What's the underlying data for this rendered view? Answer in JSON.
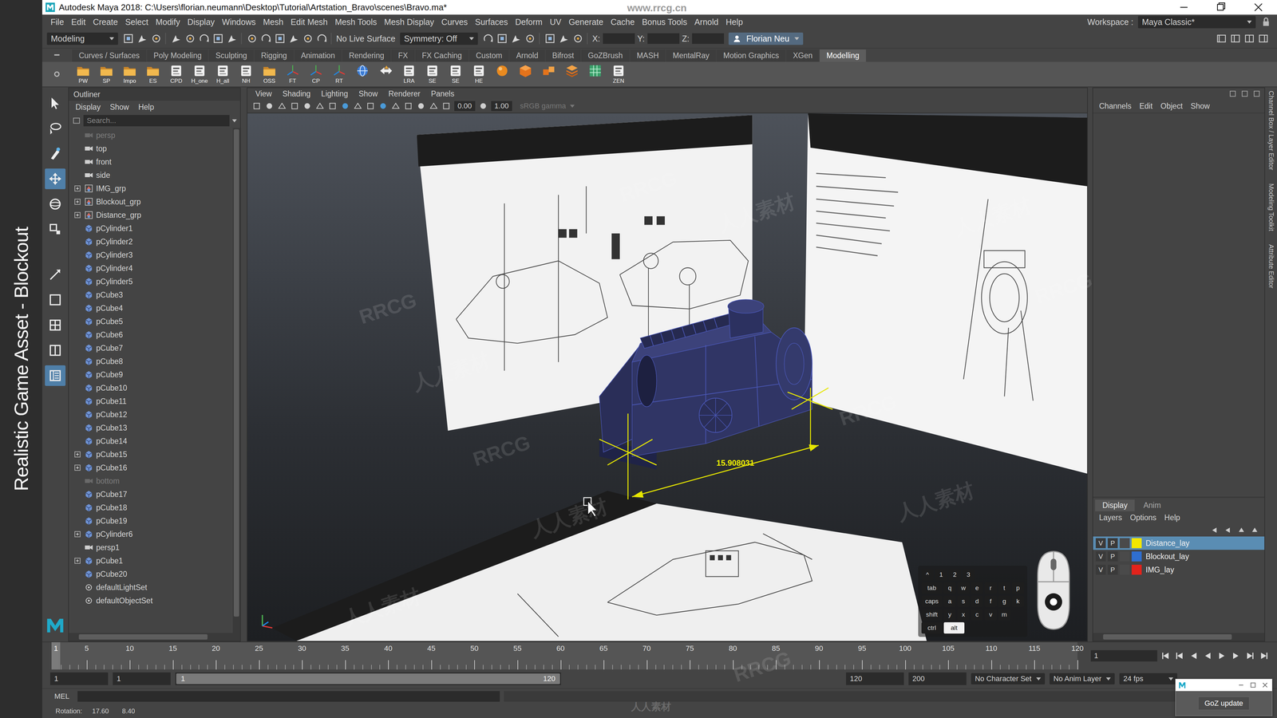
{
  "overlay_caption": "Realistic Game Asset - Blockout",
  "window": {
    "title": "Autodesk Maya 2018: C:\\Users\\florian.neumann\\Desktop\\Tutorial\\Artstation_Bravo\\scenes\\Bravo.ma*"
  },
  "menu": [
    "File",
    "Edit",
    "Create",
    "Select",
    "Modify",
    "Display",
    "Windows",
    "Mesh",
    "Edit Mesh",
    "Mesh Tools",
    "Mesh Display",
    "Curves",
    "Surfaces",
    "Deform",
    "UV",
    "Generate",
    "Cache",
    "Bonus Tools",
    "Arnold",
    "Help"
  ],
  "workspace": {
    "label": "Workspace :",
    "value": "Maya Classic*"
  },
  "status_line": {
    "menu_set": "Modeling",
    "live_surface": "No Live Surface",
    "symmetry": "Symmetry: Off",
    "coords": [
      "X:",
      "Y:",
      "Z:"
    ],
    "user": "Florian Neu"
  },
  "shelf": {
    "tabs": [
      {
        "label": "Curves / Surfaces",
        "selected": false
      },
      {
        "label": "Poly Modeling",
        "selected": false
      },
      {
        "label": "Sculpting",
        "selected": false
      },
      {
        "label": "Rigging",
        "selected": false
      },
      {
        "label": "Animation",
        "selected": false
      },
      {
        "label": "Rendering",
        "selected": false
      },
      {
        "label": "FX",
        "selected": false
      },
      {
        "label": "FX Caching",
        "selected": false
      },
      {
        "label": "Custom",
        "selected": false
      },
      {
        "label": "Arnold",
        "selected": false
      },
      {
        "label": "Bifrost",
        "selected": false
      },
      {
        "label": "GoZBrush",
        "selected": false
      },
      {
        "label": "MASH",
        "selected": false
      },
      {
        "label": "MentalRay",
        "selected": false
      },
      {
        "label": "Motion Graphics",
        "selected": false
      },
      {
        "label": "XGen",
        "selected": false
      },
      {
        "label": "Modelling",
        "selected": true
      }
    ],
    "items": [
      {
        "label": "PW",
        "kind": "folder"
      },
      {
        "label": "SP",
        "kind": "folder"
      },
      {
        "label": "Impo",
        "kind": "folder"
      },
      {
        "label": "ES",
        "kind": "folder"
      },
      {
        "label": "CPD",
        "kind": "tool"
      },
      {
        "label": "H_one",
        "kind": "tool"
      },
      {
        "label": "H_all",
        "kind": "tool"
      },
      {
        "label": "NH",
        "kind": "tool"
      },
      {
        "label": "OSS",
        "kind": "folder"
      },
      {
        "label": "FT",
        "kind": "axis"
      },
      {
        "label": "CP",
        "kind": "axis"
      },
      {
        "label": "RT",
        "kind": "axis"
      },
      {
        "label": "",
        "kind": "globe"
      },
      {
        "label": "",
        "kind": "arrows"
      },
      {
        "label": "LRA",
        "kind": "tool"
      },
      {
        "label": "SE",
        "kind": "tool"
      },
      {
        "label": "SE",
        "kind": "tool"
      },
      {
        "label": "HE",
        "kind": "tool"
      },
      {
        "label": "",
        "kind": "sphere"
      },
      {
        "label": "",
        "kind": "cube"
      },
      {
        "label": "",
        "kind": "cubes"
      },
      {
        "label": "",
        "kind": "stack"
      },
      {
        "label": "",
        "kind": "grid"
      },
      {
        "label": "ZEN",
        "kind": "tool"
      }
    ]
  },
  "toolbox": [
    {
      "kind": "select",
      "selected": false
    },
    {
      "kind": "lasso",
      "selected": false
    },
    {
      "kind": "paint",
      "selected": false
    },
    {
      "kind": "move",
      "selected": true
    },
    {
      "kind": "rotate",
      "selected": false
    },
    {
      "kind": "scale",
      "selected": false
    },
    {
      "kind": "last",
      "selected": false
    },
    {
      "kind": "single",
      "selected": false
    },
    {
      "kind": "quad",
      "selected": false
    },
    {
      "kind": "split",
      "selected": false
    },
    {
      "kind": "outliner",
      "selected": true
    }
  ],
  "outliner": {
    "title": "Outliner",
    "menu": [
      "Display",
      "Show",
      "Help"
    ],
    "search": {
      "placeholder": "Search..."
    },
    "items": [
      {
        "name": "persp",
        "kind": "camera",
        "expandable": false,
        "hidden": true
      },
      {
        "name": "top",
        "kind": "camera",
        "expandable": false,
        "hidden": false
      },
      {
        "name": "front",
        "kind": "camera",
        "expandable": false,
        "hidden": false
      },
      {
        "name": "side",
        "kind": "camera",
        "expandable": false,
        "hidden": false
      },
      {
        "name": "IMG_grp",
        "kind": "group",
        "expandable": true,
        "hidden": false
      },
      {
        "name": "Blockout_grp",
        "kind": "group",
        "expandable": true,
        "hidden": false
      },
      {
        "name": "Distance_grp",
        "kind": "group",
        "expandable": true,
        "hidden": false
      },
      {
        "name": "pCylinder1",
        "kind": "mesh",
        "expandable": false,
        "hidden": false
      },
      {
        "name": "pCylinder2",
        "kind": "mesh",
        "expandable": false,
        "hidden": false
      },
      {
        "name": "pCylinder3",
        "kind": "mesh",
        "expandable": false,
        "hidden": false
      },
      {
        "name": "pCylinder4",
        "kind": "mesh",
        "expandable": false,
        "hidden": false
      },
      {
        "name": "pCylinder5",
        "kind": "mesh",
        "expandable": false,
        "hidden": false
      },
      {
        "name": "pCube3",
        "kind": "mesh",
        "expandable": false,
        "hidden": false
      },
      {
        "name": "pCube4",
        "kind": "mesh",
        "expandable": false,
        "hidden": false
      },
      {
        "name": "pCube5",
        "kind": "mesh",
        "expandable": false,
        "hidden": false
      },
      {
        "name": "pCube6",
        "kind": "mesh",
        "expandable": false,
        "hidden": false
      },
      {
        "name": "pCube7",
        "kind": "mesh",
        "expandable": false,
        "hidden": false
      },
      {
        "name": "pCube8",
        "kind": "mesh",
        "expandable": false,
        "hidden": false
      },
      {
        "name": "pCube9",
        "kind": "mesh",
        "expandable": false,
        "hidden": false
      },
      {
        "name": "pCube10",
        "kind": "mesh",
        "expandable": false,
        "hidden": false
      },
      {
        "name": "pCube11",
        "kind": "mesh",
        "expandable": false,
        "hidden": false
      },
      {
        "name": "pCube12",
        "kind": "mesh",
        "expandable": false,
        "hidden": false
      },
      {
        "name": "pCube13",
        "kind": "mesh",
        "expandable": false,
        "hidden": false
      },
      {
        "name": "pCube14",
        "kind": "mesh",
        "expandable": false,
        "hidden": false
      },
      {
        "name": "pCube15",
        "kind": "mesh",
        "expandable": true,
        "hidden": false
      },
      {
        "name": "pCube16",
        "kind": "mesh",
        "expandable": true,
        "hidden": false
      },
      {
        "name": "bottom",
        "kind": "camera",
        "expandable": false,
        "hidden": true
      },
      {
        "name": "pCube17",
        "kind": "mesh",
        "expandable": false,
        "hidden": false
      },
      {
        "name": "pCube18",
        "kind": "mesh",
        "expandable": false,
        "hidden": false
      },
      {
        "name": "pCube19",
        "kind": "mesh",
        "expandable": false,
        "hidden": false
      },
      {
        "name": "pCylinder6",
        "kind": "mesh",
        "expandable": true,
        "hidden": false
      },
      {
        "name": "persp1",
        "kind": "camera",
        "expandable": false,
        "hidden": false
      },
      {
        "name": "pCube1",
        "kind": "mesh",
        "expandable": true,
        "hidden": false
      },
      {
        "name": "pCube20",
        "kind": "mesh",
        "expandable": false,
        "hidden": false
      },
      {
        "name": "defaultLightSet",
        "kind": "set",
        "expandable": false,
        "hidden": false
      },
      {
        "name": "defaultObjectSet",
        "kind": "set",
        "expandable": false,
        "hidden": false
      }
    ]
  },
  "viewport": {
    "menu": [
      "View",
      "Shading",
      "Lighting",
      "Show",
      "Renderer",
      "Panels"
    ],
    "fields": [
      "0.00",
      "1.00"
    ],
    "color_space": "sRGB gamma",
    "measurement": "15.908031"
  },
  "keyboard_overlay": {
    "rows": [
      [
        {
          "label": "^",
          "pressed": false
        },
        {
          "label": "1",
          "pressed": false
        },
        {
          "label": "2",
          "pressed": false
        },
        {
          "label": "3",
          "pressed": false
        }
      ],
      [
        {
          "label": "tab",
          "pressed": false
        },
        {
          "label": "q",
          "pressed": false
        },
        {
          "label": "w",
          "pressed": false
        },
        {
          "label": "e",
          "pressed": false
        },
        {
          "label": "r",
          "pressed": false
        },
        {
          "label": "t",
          "pressed": false
        },
        {
          "label": "p",
          "pressed": false
        }
      ],
      [
        {
          "label": "caps",
          "pressed": false
        },
        {
          "label": "a",
          "pressed": false
        },
        {
          "label": "s",
          "pressed": false
        },
        {
          "label": "d",
          "pressed": false
        },
        {
          "label": "f",
          "pressed": false
        },
        {
          "label": "g",
          "pressed": false
        },
        {
          "label": "k",
          "pressed": false
        }
      ],
      [
        {
          "label": "shift",
          "pressed": false
        },
        {
          "label": "y",
          "pressed": false
        },
        {
          "label": "x",
          "pressed": false
        },
        {
          "label": "c",
          "pressed": false
        },
        {
          "label": "v",
          "pressed": false
        },
        {
          "label": "m",
          "pressed": false
        }
      ],
      [
        {
          "label": "ctrl",
          "pressed": false
        },
        {
          "label": "alt",
          "pressed": true
        }
      ]
    ]
  },
  "channel_box": {
    "tabs": [
      "Channels",
      "Edit",
      "Object",
      "Show"
    ]
  },
  "layer_editor": {
    "tabs": [
      {
        "label": "Display",
        "selected": true
      },
      {
        "label": "Anim",
        "selected": false
      }
    ],
    "menu": [
      "Layers",
      "Options",
      "Help"
    ],
    "layers": [
      {
        "v": "V",
        "p": "P",
        "name": "Distance_lay",
        "color": "#f2e600",
        "selected": true
      },
      {
        "v": "V",
        "p": "P",
        "name": "Blockout_lay",
        "color": "#2f6fd0",
        "selected": false
      },
      {
        "v": "V",
        "p": "P",
        "name": "IMG_lay",
        "color": "#e2231c",
        "selected": false
      }
    ]
  },
  "side_tabs": [
    "Channel Box / Layer Editor",
    "Modeling Toolkit",
    "Attribute Editor"
  ],
  "timeline": {
    "current": "1",
    "ticks": [
      "5",
      "10",
      "15",
      "20",
      "25",
      "30",
      "35",
      "40",
      "45",
      "50",
      "55",
      "60",
      "65",
      "70",
      "75",
      "80",
      "85",
      "90",
      "95",
      "100",
      "105",
      "110",
      "115",
      "120"
    ],
    "frame_field": "1"
  },
  "range": {
    "start": "1",
    "playback_start": "1",
    "slider_start": "1",
    "slider_end": "120",
    "playback_end": "120",
    "end": "200",
    "character_set": "No Character Set",
    "anim_layer": "No Anim Layer",
    "fps": "24 fps"
  },
  "command_line": {
    "language": "MEL"
  },
  "help_line": {
    "label": "Rotation:",
    "values": [
      "17.60",
      "8.40"
    ]
  },
  "goz": {
    "button": "GoZ update"
  },
  "watermarks": [
    {
      "text": "www.rrcg.cn",
      "kind": "flat"
    },
    {
      "text": "人人素材",
      "kind": "flat"
    },
    {
      "text": "RRCG",
      "kind": "diagonal"
    },
    {
      "text": "人人素材",
      "kind": "diagonal"
    },
    {
      "text": "RRCG",
      "kind": "diagonal"
    },
    {
      "text": "人人素材",
      "kind": "diagonal"
    },
    {
      "text": "RRCG",
      "kind": "diagonal"
    },
    {
      "text": "人人素材",
      "kind": "diagonal"
    },
    {
      "text": "RRCG",
      "kind": "diagonal"
    },
    {
      "text": "人人素材",
      "kind": "diagonal"
    },
    {
      "text": "RRCG",
      "kind": "diagonal"
    },
    {
      "text": "人人素材",
      "kind": "diagonal"
    },
    {
      "text": "RRCG",
      "kind": "diagonal"
    },
    {
      "text": "人人素材",
      "kind": "diagonal"
    }
  ]
}
